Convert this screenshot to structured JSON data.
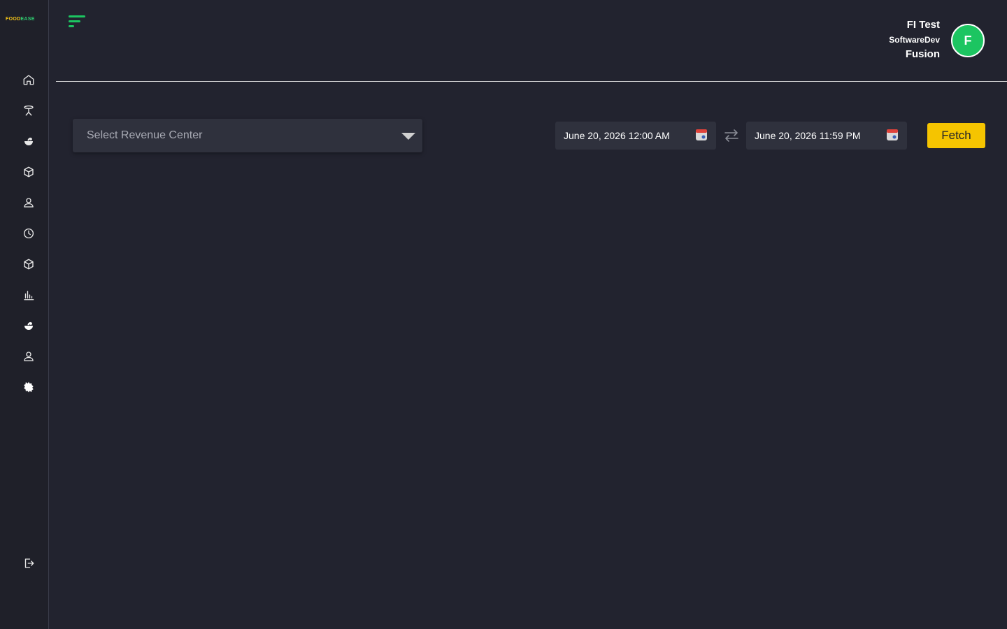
{
  "brand": {
    "logo_part1": "FOOD",
    "logo_part2": "EASE"
  },
  "sidebar": {
    "items": [
      {
        "icon": "home-icon"
      },
      {
        "icon": "table-icon"
      },
      {
        "icon": "food-icon"
      },
      {
        "icon": "box-icon"
      },
      {
        "icon": "user-icon"
      },
      {
        "icon": "clock-icon"
      },
      {
        "icon": "package-icon"
      },
      {
        "icon": "chart-icon"
      },
      {
        "icon": "food-icon"
      },
      {
        "icon": "user-icon"
      },
      {
        "icon": "settings-icon"
      }
    ],
    "logout_icon": "logout-icon"
  },
  "user": {
    "name": "FI Test",
    "org": "SoftwareDev",
    "site": "Fusion",
    "avatar_initial": "F"
  },
  "filters": {
    "revenue_center_placeholder": "Select Revenue Center",
    "start_date": "June 20, 2026 12:00 AM",
    "end_date": "June 20, 2026 11:59 PM",
    "fetch_label": "Fetch"
  },
  "colors": {
    "background": "#22232f",
    "sidebar": "#1f2029",
    "accent_yellow": "#f5c400",
    "accent_green": "#1cc561"
  }
}
